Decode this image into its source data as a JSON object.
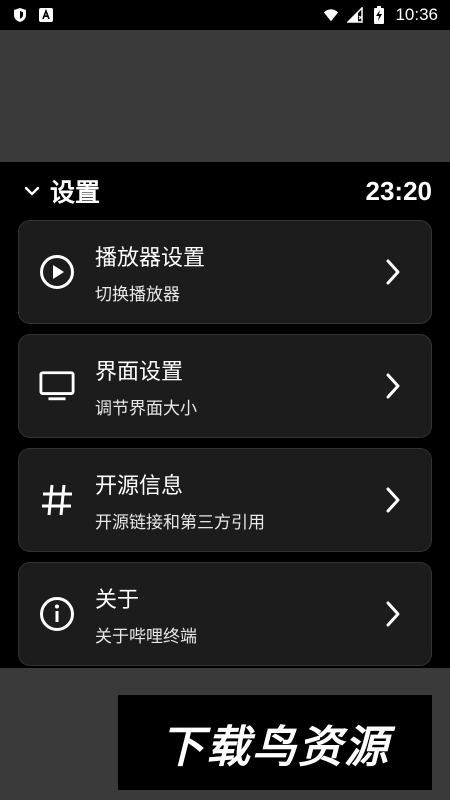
{
  "status_bar": {
    "time": "10:36",
    "icons": [
      "shield-icon",
      "a-badge-icon",
      "wifi-icon",
      "signal-icon",
      "battery-charging-icon"
    ]
  },
  "header": {
    "title": "设置",
    "clock": "23:20",
    "toggle_icon": "chevron-down-icon"
  },
  "menu": {
    "items": [
      {
        "title": "播放器设置",
        "subtitle": "切换播放器",
        "icon": "play-circle-icon"
      },
      {
        "title": "界面设置",
        "subtitle": "调节界面大小",
        "icon": "monitor-icon"
      },
      {
        "title": "开源信息",
        "subtitle": "开源链接和第三方引用",
        "icon": "hash-icon"
      },
      {
        "title": "关于",
        "subtitle": "关于哔哩终端",
        "icon": "info-icon"
      }
    ]
  },
  "watermark": {
    "text": "下载鸟资源"
  },
  "colors": {
    "panel_bg": "#000000",
    "card_bg": "#1c1c1c",
    "outer_bg": "#3a3a3a",
    "text": "#ffffff"
  }
}
